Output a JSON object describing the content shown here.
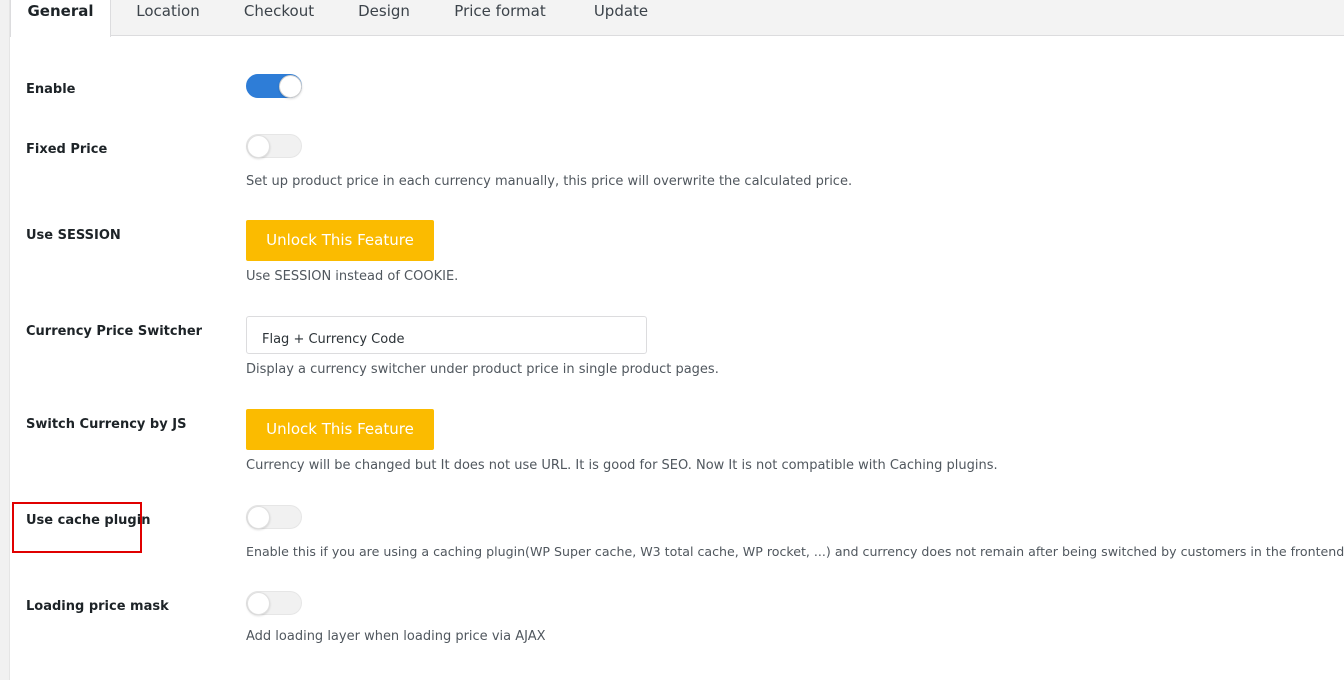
{
  "tabs": [
    {
      "label": "General",
      "active": true
    },
    {
      "label": "Location"
    },
    {
      "label": "Checkout"
    },
    {
      "label": "Design"
    },
    {
      "label": "Price format"
    },
    {
      "label": "Update"
    }
  ],
  "settings": {
    "enable": {
      "label": "Enable",
      "on": true
    },
    "fixed_price": {
      "label": "Fixed Price",
      "on": false,
      "description": "Set up product price in each currency manually, this price will overwrite the calculated price."
    },
    "use_session": {
      "label": "Use SESSION",
      "button": "Unlock This Feature",
      "description": "Use SESSION instead of COOKIE."
    },
    "currency_price_switcher": {
      "label": "Currency Price Switcher",
      "value": "Flag + Currency Code",
      "description": "Display a currency switcher under product price in single product pages."
    },
    "switch_currency_js": {
      "label": "Switch Currency by JS",
      "button": "Unlock This Feature",
      "description": "Currency will be changed but It does not use URL. It is good for SEO. Now It is not compatible with Caching plugins."
    },
    "use_cache_plugin": {
      "label": "Use cache plugin",
      "on": false,
      "description": "Enable this if you are using a caching plugin(WP Super cache, W3 total cache, WP rocket, ...) and currency does not remain after being switched by customers in the frontend"
    },
    "loading_price_mask": {
      "label": "Loading price mask",
      "on": false,
      "description": "Add loading layer when loading price via AJAX"
    }
  },
  "colors": {
    "accent": "#2e7dd7",
    "unlock": "#fbbb00",
    "highlight": "#e00000"
  }
}
